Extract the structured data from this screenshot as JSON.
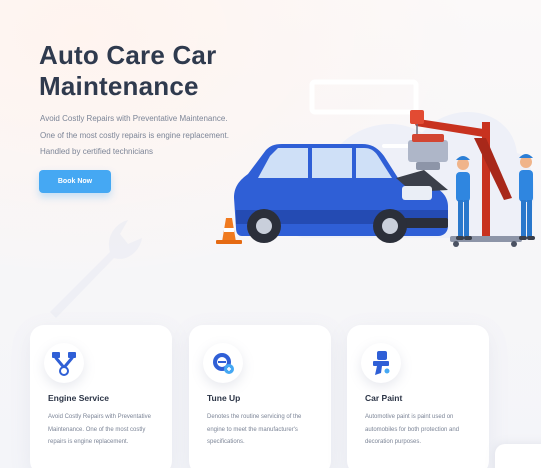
{
  "hero": {
    "title_line1": "Auto Care Car",
    "title_line2": "Maintenance",
    "desc_line1": "Avoid Costly Repairs with Preventative Maintenance.",
    "desc_line2": "One of the most costly repairs is engine replacement.",
    "desc_line3": "Handled by certified technicians",
    "cta_label": "Book Now"
  },
  "colors": {
    "accent": "#45a8f3",
    "title": "#2f3a4e",
    "body_text": "#7c8597",
    "car_blue": "#2f5fd6",
    "crane_red": "#c8321f"
  },
  "services": [
    {
      "icon": "engine-pistons-icon",
      "title": "Engine Service",
      "desc": "Avoid Costly Repairs with Preventative Maintenance. One of the most costly repairs is engine replacement."
    },
    {
      "icon": "tune-up-gauge-icon",
      "title": "Tune Up",
      "desc": "Denotes the routine servicing of the engine to meet the manufacturer's specifications."
    },
    {
      "icon": "paint-brush-icon",
      "title": "Car Paint",
      "desc": "Automotive paint is paint used on automobiles for both protection and decoration purposes."
    }
  ]
}
